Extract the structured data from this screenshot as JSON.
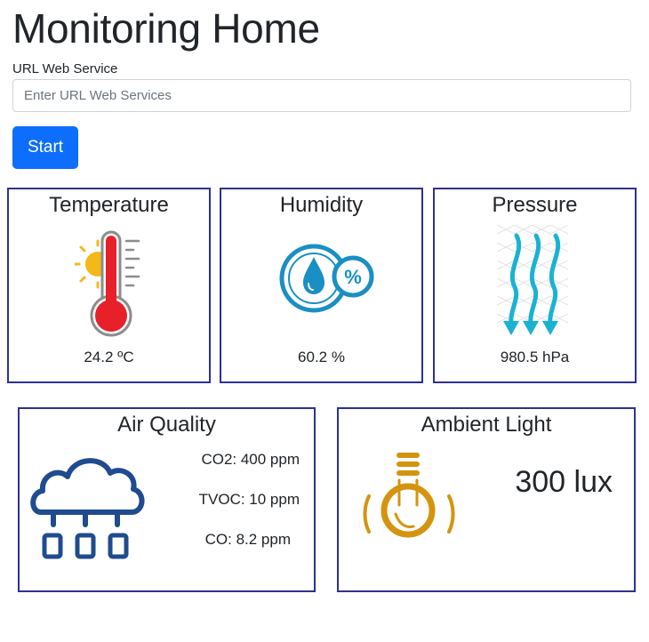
{
  "page": {
    "title": "Monitoring Home"
  },
  "form": {
    "url_label": "URL Web Service",
    "url_placeholder": "Enter URL Web Services",
    "url_value": "",
    "start_label": "Start"
  },
  "cards": {
    "temperature": {
      "title": "Temperature",
      "value": "24.2 ºC",
      "icon": "thermometer-sun-icon"
    },
    "humidity": {
      "title": "Humidity",
      "value": "60.2 %",
      "icon": "water-drop-percent-icon"
    },
    "pressure": {
      "title": "Pressure",
      "value": "980.5 hPa",
      "icon": "pressure-arrows-icon"
    },
    "air_quality": {
      "title": "Air Quality",
      "co2": "CO2: 400 ppm",
      "tvoc": "TVOC: 10 ppm",
      "co": "CO: 8.2 ppm",
      "icon": "cloud-air-icon"
    },
    "ambient_light": {
      "title": "Ambient Light",
      "value": "300 lux",
      "icon": "light-bulb-icon"
    }
  },
  "colors": {
    "card_border": "#2e3192",
    "primary_button": "#0d6efd",
    "thermometer_red": "#e8202a",
    "sun_yellow": "#f5b819",
    "humidity_blue": "#1a8fc4",
    "pressure_cyan": "#1ab2d3",
    "cloud_navy": "#1f4b8f",
    "bulb_gold": "#d4940f"
  }
}
